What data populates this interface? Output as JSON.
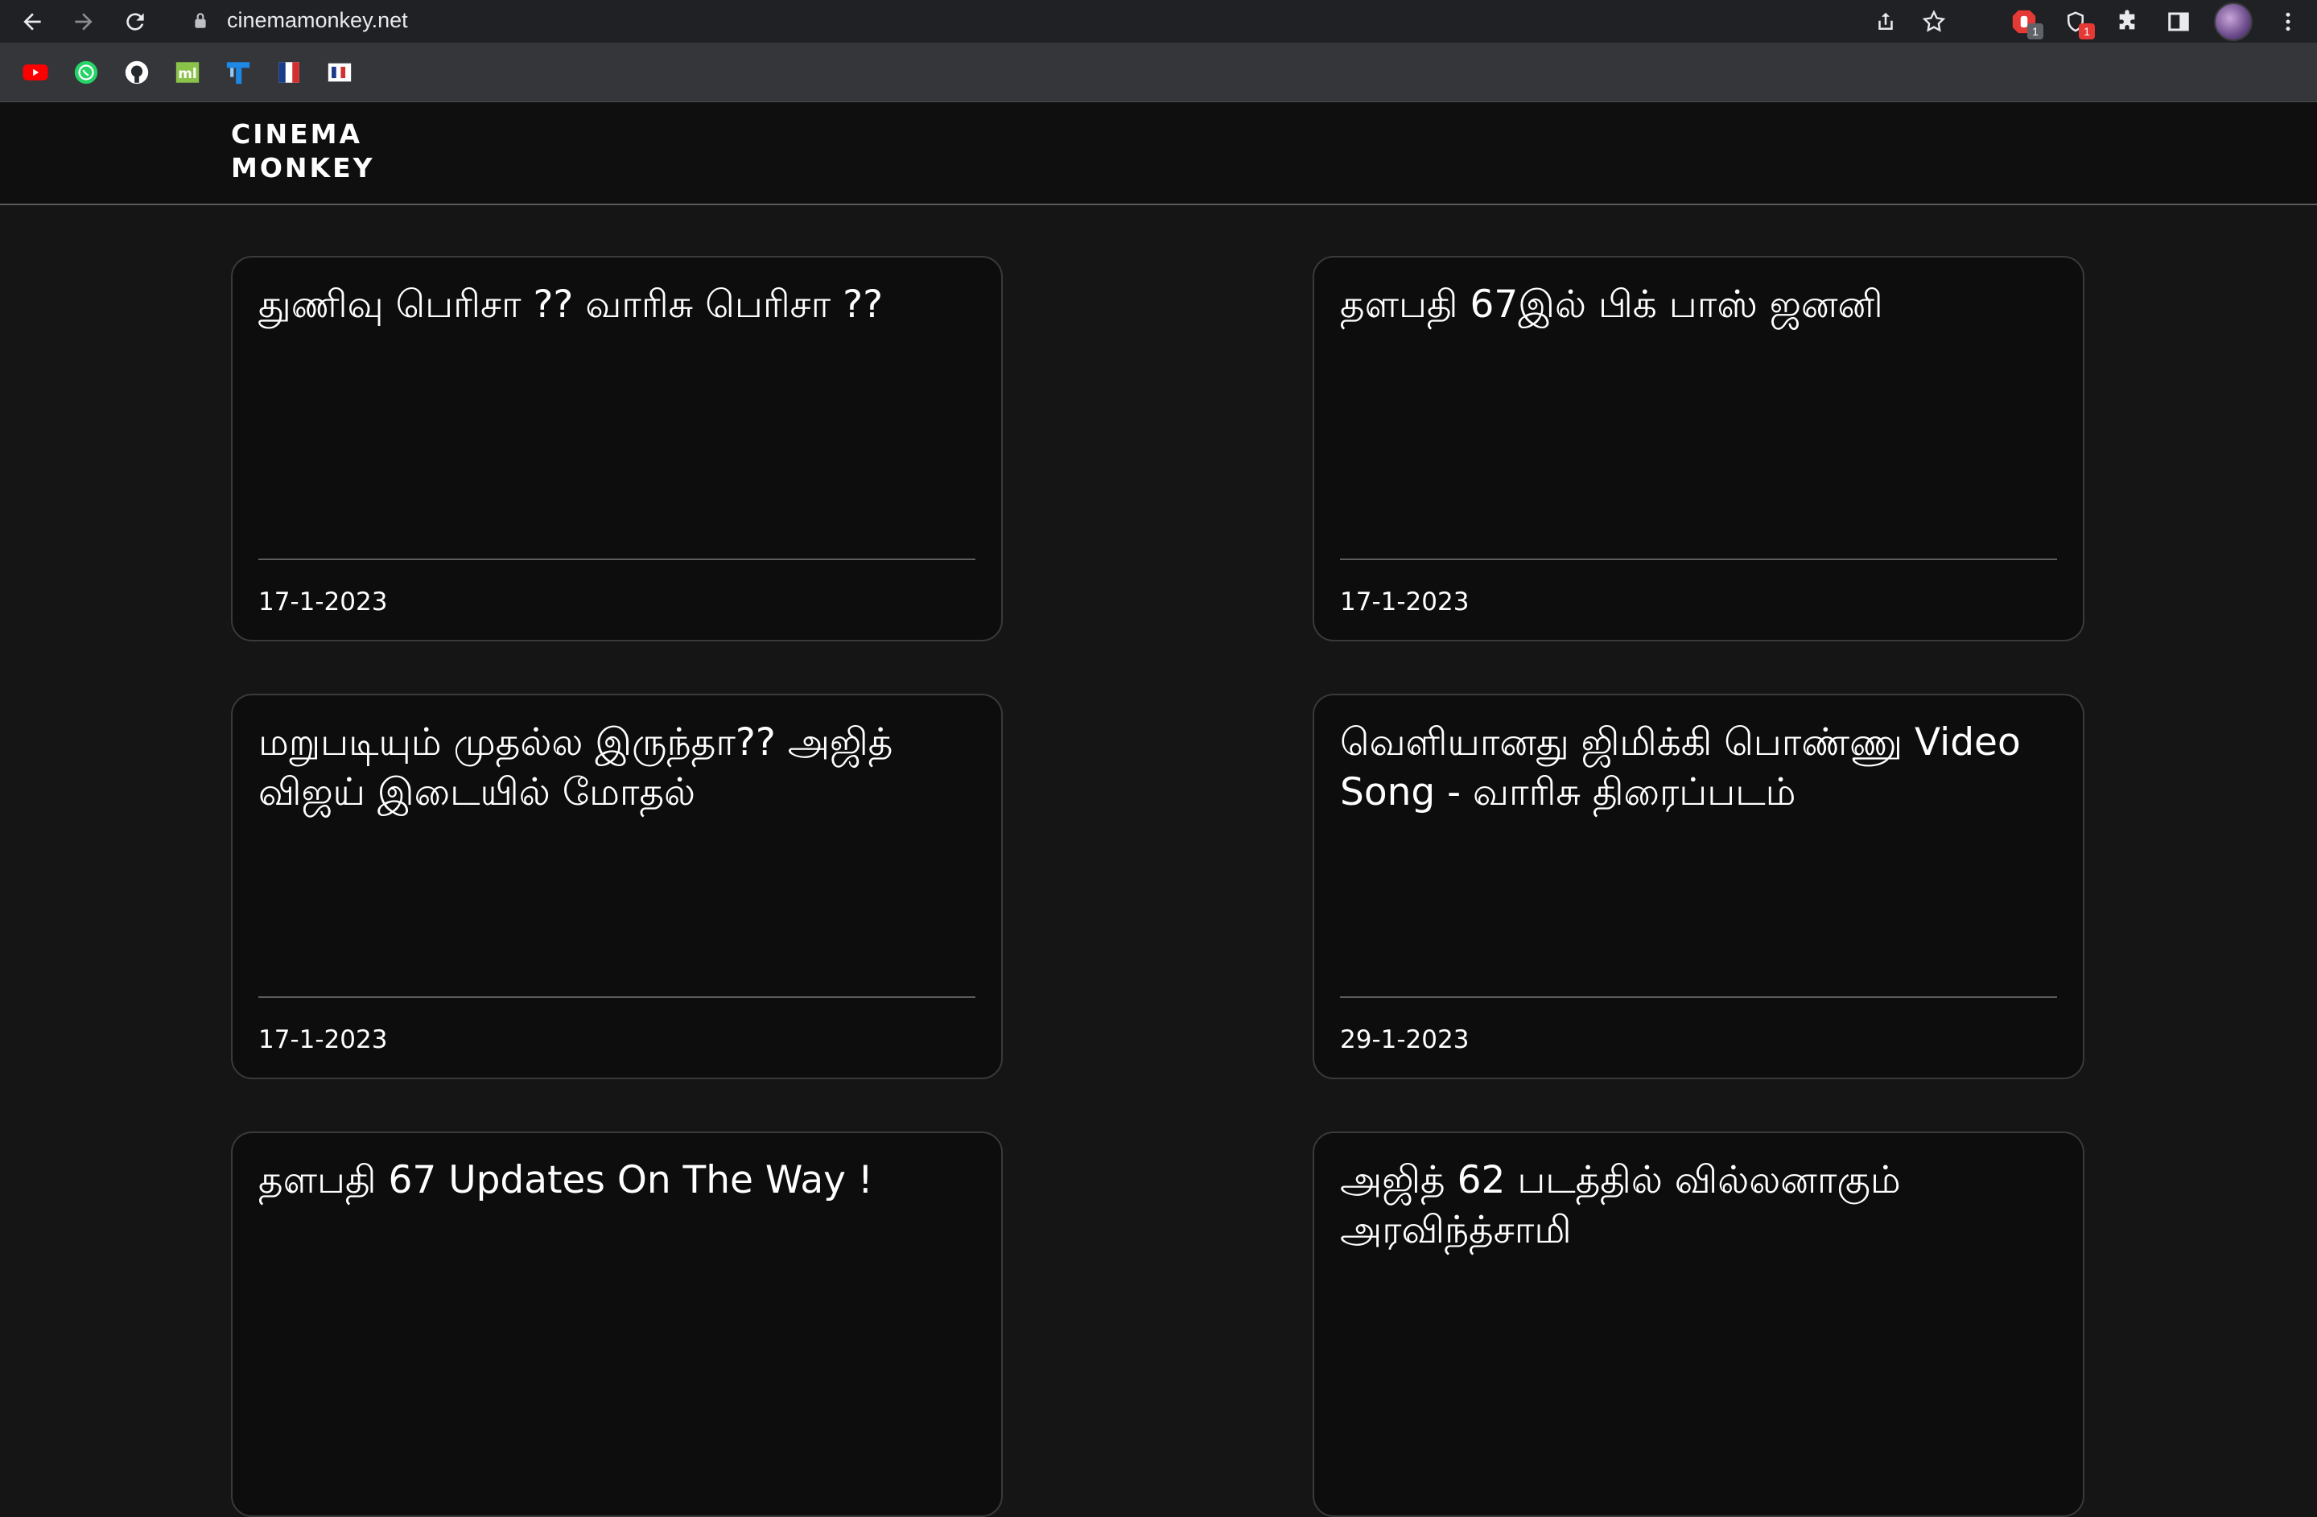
{
  "browser": {
    "url": "cinemamonkey.net",
    "extension_badges": [
      "1",
      "1"
    ]
  },
  "site": {
    "logo_line1": "CINEMA",
    "logo_line2": "MONKEY"
  },
  "posts": [
    {
      "title": "துணிவு பெரிசா ?? வாரிசு பெரிசா ??",
      "date": "17-1-2023"
    },
    {
      "title": "தளபதி 67இல் பிக் பாஸ் ஜனனி",
      "date": "17-1-2023"
    },
    {
      "title": "மறுபடியும் முதல்ல இருந்தா?? அஜித் விஜய் இடையில் மோதல்",
      "date": "17-1-2023"
    },
    {
      "title": "வெளியானது ஜிமிக்கி பொண்ணு Video Song - வாரிசு திரைப்படம்",
      "date": "29-1-2023"
    },
    {
      "title": "தளபதி 67 Updates On The Way !",
      "date": ""
    },
    {
      "title": "அஜித் 62 படத்தில் வில்லனாகும் அரவிந்த்சாமி",
      "date": ""
    }
  ],
  "colors": {
    "page_bg": "#151515",
    "card_bg": "#0d0d0d",
    "card_border": "#3a3a3a",
    "text": "#ffffff"
  }
}
